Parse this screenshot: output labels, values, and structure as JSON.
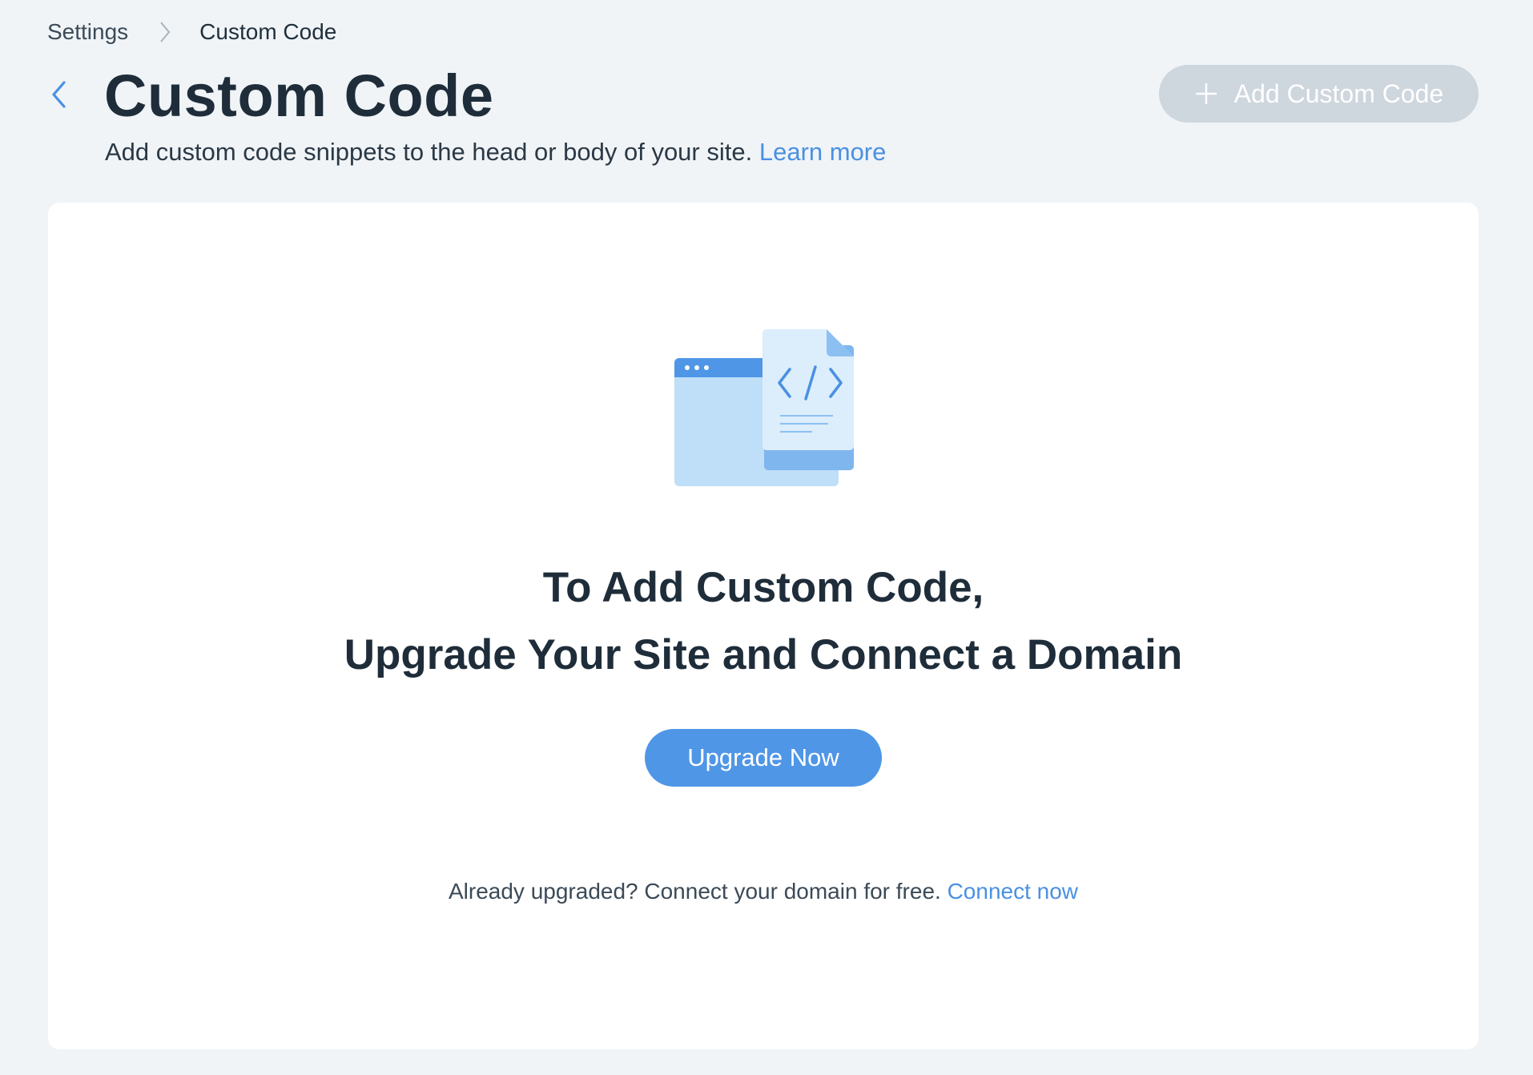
{
  "breadcrumb": {
    "root": "Settings",
    "separator_icon": "chevron-right-icon",
    "current": "Custom Code"
  },
  "header": {
    "back_icon": "chevron-left-icon",
    "title": "Custom Code",
    "subtitle": "Add custom code snippets to the head or body of your site.",
    "learn_more": "Learn more",
    "add_button": {
      "icon": "plus-icon",
      "label": "Add Custom Code",
      "disabled": true
    }
  },
  "empty_state": {
    "illustration": "code-file-illustration",
    "headline_line1": "To Add Custom Code,",
    "headline_line2": "Upgrade Your Site and Connect a Domain",
    "upgrade_button": "Upgrade Now",
    "footer_text": "Already upgraded? Connect your domain for free.",
    "connect_link": "Connect now"
  },
  "colors": {
    "page_background": "#f0f4f7",
    "accent": "#4a90e2",
    "primary_button": "#4f96e6",
    "disabled_button": "#ced6de",
    "heading_text": "#1f2d3a"
  }
}
